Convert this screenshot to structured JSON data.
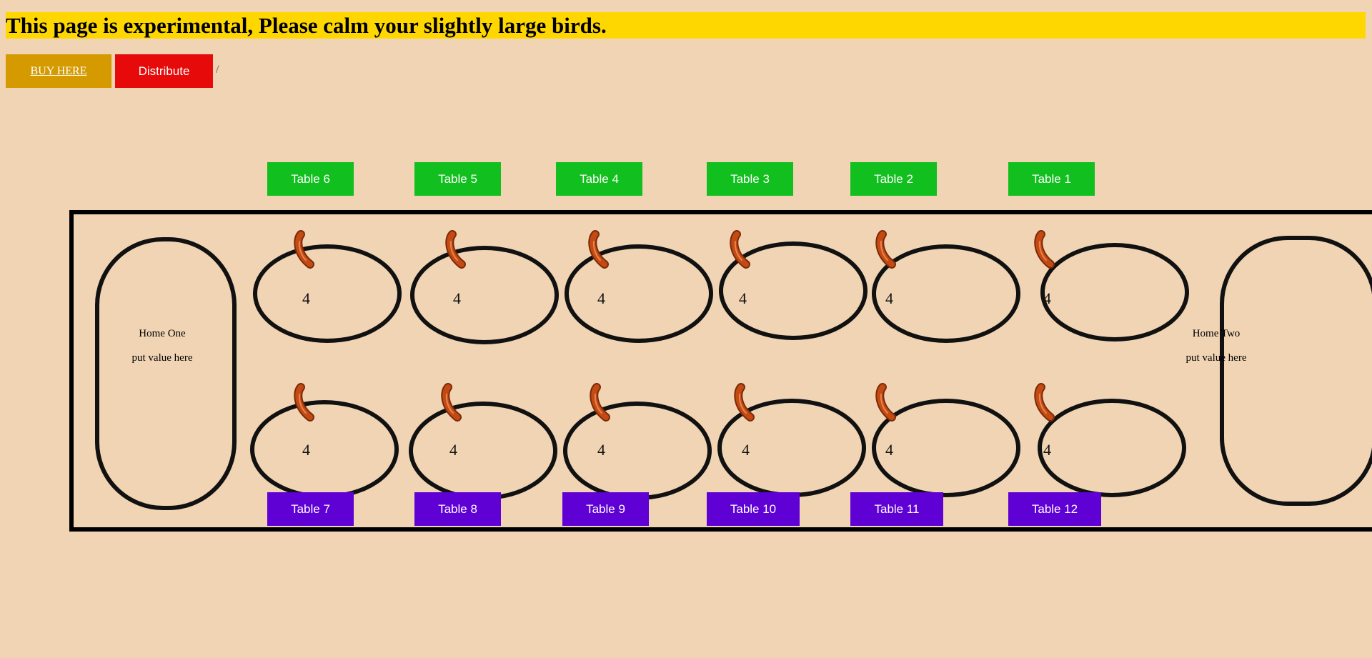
{
  "banner": {
    "text": "This page is experimental, Please calm your slightly large birds."
  },
  "controls": {
    "buy_label": "BUY HERE",
    "distribute_label": "Distribute",
    "separator": "/"
  },
  "top_tables": [
    {
      "label": "Table 6",
      "count": "4"
    },
    {
      "label": "Table 5",
      "count": "4"
    },
    {
      "label": "Table 4",
      "count": "4"
    },
    {
      "label": "Table 3",
      "count": "4"
    },
    {
      "label": "Table 2",
      "count": "4"
    },
    {
      "label": "Table 1",
      "count": "4"
    }
  ],
  "bottom_tables": [
    {
      "label": "Table 7",
      "count": "4"
    },
    {
      "label": "Table 8",
      "count": "4"
    },
    {
      "label": "Table 9",
      "count": "4"
    },
    {
      "label": "Table 10",
      "count": "4"
    },
    {
      "label": "Table 11",
      "count": "4"
    },
    {
      "label": "Table 12",
      "count": "4"
    }
  ],
  "home_one": {
    "title": "Home One",
    "value": "put value here"
  },
  "home_two": {
    "title": "Home Two",
    "value": "put value here"
  },
  "icons": {
    "pit_marker": "sausage-icon"
  },
  "colors": {
    "background": "#f0d4b4",
    "banner": "#ffd700",
    "buy_button": "#d49a00",
    "distribute_button": "#e60a0a",
    "top_table_button": "#11bf1e",
    "bottom_table_button": "#5f00d4"
  }
}
